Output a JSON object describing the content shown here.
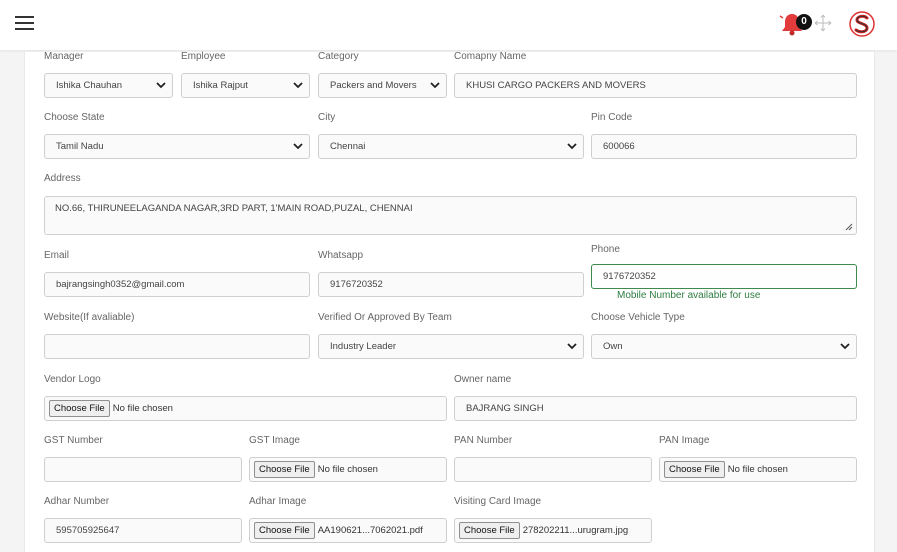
{
  "header": {
    "notification_count": "0",
    "menu_icon": "hamburger-icon",
    "bell_icon": "bell-icon",
    "move_icon": "move-icon",
    "logo_icon": "brand-logo-icon",
    "bell_color": "#e23b3b"
  },
  "form": {
    "manager": {
      "label": "Manager",
      "value": "Ishika Chauhan"
    },
    "employee": {
      "label": "Employee",
      "value": "Ishika Rajput"
    },
    "category": {
      "label": "Category",
      "value": "Packers and Movers"
    },
    "company": {
      "label": "Comapny Name",
      "value": "KHUSI CARGO PACKERS AND MOVERS"
    },
    "state": {
      "label": "Choose State",
      "value": "Tamil Nadu"
    },
    "city": {
      "label": "City",
      "value": "Chennai"
    },
    "pincode": {
      "label": "Pin Code",
      "value": "600066"
    },
    "address": {
      "label": "Address",
      "value": "NO.66, THIRUNEELAGANDA NAGAR,3RD PART, 1'MAIN ROAD,PUZAL, CHENNAI"
    },
    "email": {
      "label": "Email",
      "value": "bajrangsingh0352@gmail.com"
    },
    "whatsapp": {
      "label": "Whatsapp",
      "value": "9176720352"
    },
    "phone": {
      "label": "Phone",
      "value": "9176720352",
      "helper": "Mobile Number available for use"
    },
    "website": {
      "label": "Website(If avaliable)",
      "value": ""
    },
    "verified": {
      "label": "Verified Or Approved By Team",
      "value": "Industry Leader"
    },
    "vehicle": {
      "label": "Choose Vehicle Type",
      "value": "Own"
    },
    "vendor_logo": {
      "label": "Vendor Logo",
      "button": "Choose File",
      "filename": "No file chosen"
    },
    "owner": {
      "label": "Owner name",
      "value": "BAJRANG SINGH"
    },
    "gst_number": {
      "label": "GST Number",
      "value": ""
    },
    "gst_image": {
      "label": "GST Image",
      "button": "Choose File",
      "filename": "No file chosen"
    },
    "pan_number": {
      "label": "PAN Number",
      "value": ""
    },
    "pan_image": {
      "label": "PAN Image",
      "button": "Choose File",
      "filename": "No file chosen"
    },
    "adhar_number": {
      "label": "Adhar Number",
      "value": "595705925647"
    },
    "adhar_image": {
      "label": "Adhar Image",
      "button": "Choose File",
      "filename": "AA190621...7062021.pdf"
    },
    "visiting_card": {
      "label": "Visiting Card Image",
      "button": "Choose File",
      "filename": "278202211...urugram.jpg"
    }
  }
}
